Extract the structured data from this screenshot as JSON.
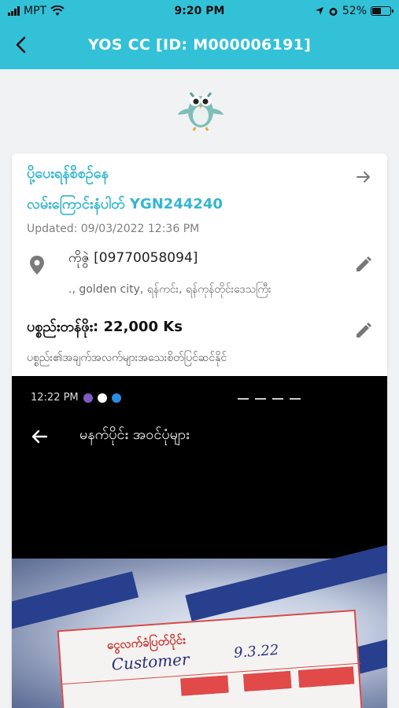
{
  "status_bar": {
    "carrier": "MPT",
    "time": "9:20 PM",
    "battery": "52%",
    "battery_level": 0.52
  },
  "header": {
    "title": "YOS CC [ID: M000006191]"
  },
  "order": {
    "status": "ပို့ပေးရန်စိစဉ်နေ",
    "route": "လမ်းကြောင်းနံပါတ် YGN244240",
    "updated": "Updated: 09/03/2022 12:36 PM",
    "receiver": "ကိုဇွဲ [09770058094]",
    "address": "., golden city, ရန်ကင်း, ရန်ကုန်တိုင်းဒေသကြီး",
    "fee": "ပစ္စည်းတန်ဖိုး: 22,000 Ks",
    "note": "ပစ္စည်း၏အချက်အလက်များအသေးစိတ်ပြင်ဆင်နိုင်"
  },
  "photo": {
    "status_time": "12:22 PM",
    "screen_title": "မနက်ပိုင်း အဝင်ပုံများ",
    "slip_title": "ငွေလက်ခံပြတ်ပိုင်း",
    "handwriting": "Customer",
    "handwriting_date": "9.3.22"
  },
  "colors": {
    "brand": "#33c1d8",
    "accent_text": "#33b6cf"
  }
}
